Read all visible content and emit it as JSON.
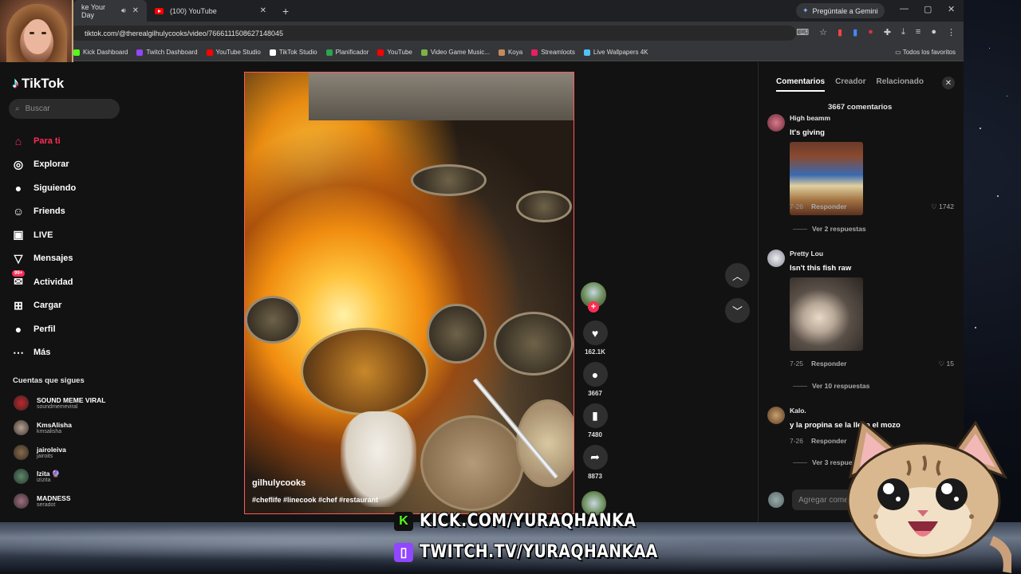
{
  "browser": {
    "tabs": [
      {
        "label": "ke Your Day",
        "icon": "speaker-icon",
        "active": true
      },
      {
        "label": "(100) YouTube",
        "icon": "youtube-icon",
        "active": false
      }
    ],
    "gemini_label": "Pregúntale a Gemini",
    "url": "tiktok.com/@therealgilhulycooks/video/7666111508627148045",
    "bookmarks": [
      "Kick Dashboard",
      "Twitch Dashboard",
      "YouTube Studio",
      "TikTok Studio",
      "Planificador",
      "YouTube",
      "Video Game Music...",
      "Koya",
      "Streamloots",
      "Live Wallpapers 4K"
    ],
    "bookmark_colors": [
      "#53fc18",
      "#9146ff",
      "#ff0000",
      "#ffffff",
      "#2da44e",
      "#ff0000",
      "#7cb342",
      "#c58a5a",
      "#e91e63",
      "#4fc3f7"
    ],
    "all_bookmarks": "Todos los favoritos"
  },
  "tiktok": {
    "logo": "TikTok",
    "search_placeholder": "Buscar",
    "nav": [
      {
        "label": "Para ti",
        "icon": "home-icon",
        "glyph": "⌂"
      },
      {
        "label": "Explorar",
        "icon": "compass-icon",
        "glyph": "◎"
      },
      {
        "label": "Siguiendo",
        "icon": "following-avatar-icon",
        "glyph": "●"
      },
      {
        "label": "Friends",
        "icon": "friends-icon",
        "glyph": "☺"
      },
      {
        "label": "LIVE",
        "icon": "live-icon",
        "glyph": "▣"
      },
      {
        "label": "Mensajes",
        "icon": "messages-icon",
        "glyph": "▽"
      },
      {
        "label": "Actividad",
        "icon": "activity-icon",
        "glyph": "✉"
      },
      {
        "label": "Cargar",
        "icon": "upload-icon",
        "glyph": "⊞"
      },
      {
        "label": "Perfil",
        "icon": "profile-avatar-icon",
        "glyph": "●"
      },
      {
        "label": "Más",
        "icon": "more-icon",
        "glyph": "⋯"
      }
    ],
    "activity_badge": "99+",
    "following_title": "Cuentas que sigues",
    "following": [
      {
        "name": "SOUND MEME VIRAL",
        "handle": "soundmemeviral",
        "color": "#c0282d"
      },
      {
        "name": "KmsAlisha",
        "handle": "kmsalisha",
        "color": "#b8a090"
      },
      {
        "name": "jairoleiva",
        "handle": "jairoits",
        "color": "#8a6a4a"
      },
      {
        "name": "Izita 🔮",
        "handle": "izizita",
        "color": "#5a8a6a"
      },
      {
        "name": "MADNESS",
        "handle": "seradot",
        "color": "#a07080"
      }
    ],
    "video": {
      "username": "gilhulycooks",
      "hashtags": "#cheflife #linecook #chef #restaurant"
    },
    "actions": [
      {
        "icon": "heart-icon",
        "glyph": "♥",
        "count": "162.1K"
      },
      {
        "icon": "comment-icon",
        "glyph": "●",
        "count": "3667"
      },
      {
        "icon": "bookmark-icon",
        "glyph": "▮",
        "count": "7480"
      },
      {
        "icon": "share-icon",
        "glyph": "➦",
        "count": "8873"
      }
    ],
    "comments_panel": {
      "tabs": [
        "Comentarios",
        "Creador",
        "Relacionado"
      ],
      "count": "3667 comentarios",
      "comments": [
        {
          "user": "High beamm",
          "text": "It's giving",
          "date": "7-26",
          "reply": "Responder",
          "likes": "1742",
          "replies": "Ver 2 respuestas"
        },
        {
          "user": "Pretty Lou",
          "text": "Isn't this fish raw",
          "date": "7-25",
          "reply": "Responder",
          "likes": "15",
          "replies": "Ver 10 respuestas"
        },
        {
          "user": "Kalo.",
          "text": "y la propina se la lleva el mozo",
          "date": "7-26",
          "reply": "Responder",
          "likes": "",
          "replies": "Ver 3 respuestas"
        }
      ],
      "add_placeholder": "Agregar comentario..."
    }
  },
  "overlay": {
    "kick": "KICK.COM/YURAQHANKA",
    "twitch": "TWITCH.TV/YURAQHANKAA",
    "kick_color": "#53fc18",
    "twitch_color": "#9146ff"
  }
}
